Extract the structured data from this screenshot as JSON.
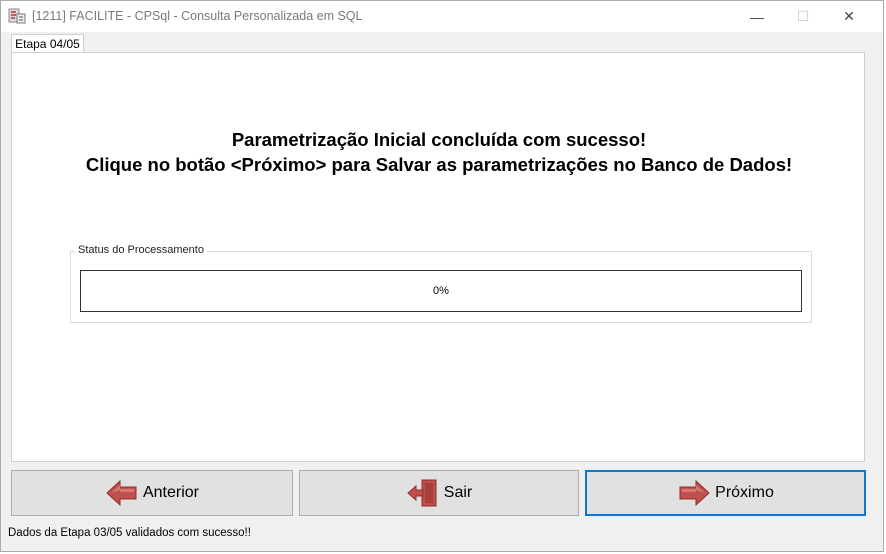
{
  "window": {
    "title": "[1211] FACILITE - CPSql - Consulta Personalizada em SQL",
    "minimize_symbol": "—",
    "maximize_symbol": "☐",
    "close_symbol": "✕"
  },
  "tab": {
    "label": "Etapa 04/05"
  },
  "message": {
    "line1": "Parametrização Inicial concluída com sucesso!",
    "line2": "Clique no botão <Próximo> para Salvar as parametrizações no Banco de Dados!"
  },
  "status_group": {
    "label": "Status do Processamento",
    "progress_text": "0%",
    "progress_value": 0
  },
  "buttons": {
    "previous": "Anterior",
    "exit": "Sair",
    "next": "Próximo"
  },
  "statusbar": {
    "text": "Dados da Etapa 03/05 validados com sucesso!!"
  },
  "icons": {
    "app": "app-icon",
    "previous": "arrow-left-icon",
    "exit": "exit-door-icon",
    "next": "arrow-right-icon"
  },
  "colors": {
    "focus_border": "#0a78d7",
    "arrow_red": "#c0504d",
    "button_face": "#e1e1e1"
  }
}
